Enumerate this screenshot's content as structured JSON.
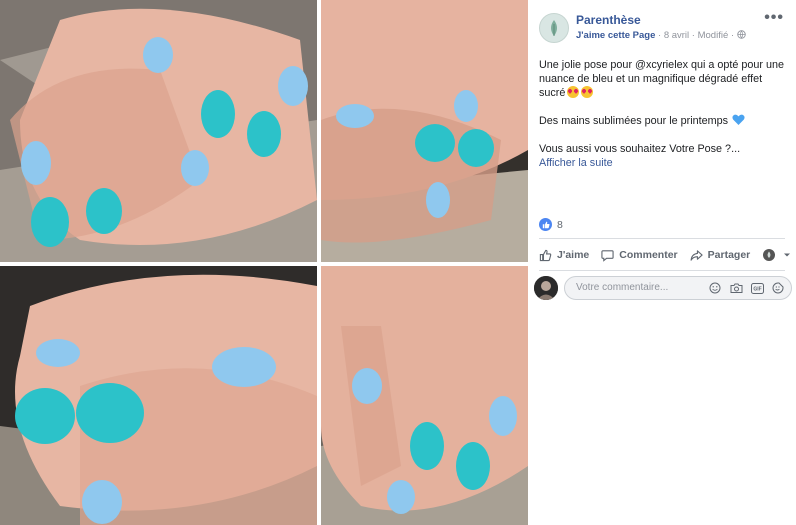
{
  "post": {
    "page_name": "Parenthèse",
    "like_page": "J'aime cette Page",
    "date": "8 avril",
    "modified": "Modifié",
    "text_1": "Une jolie pose pour @xcyrielex qui a opté pour une nuance de bleu et un magnifique dégradé effet sucré",
    "text_2": "Des mains sublimées pour le printemps",
    "text_3": "Vous aussi vous souhaitez Votre Pose ?...",
    "see_more": "Afficher la suite"
  },
  "reactions": {
    "count": "8"
  },
  "actions": {
    "like": "J'aime",
    "comment": "Commenter",
    "share": "Partager"
  },
  "comment_box": {
    "placeholder": "Votre commentaire..."
  },
  "colors": {
    "link": "#385898",
    "nail_light": "#8fc8ee",
    "nail_glitter": "#2cc2c9",
    "like_blue": "#4c86f2"
  }
}
